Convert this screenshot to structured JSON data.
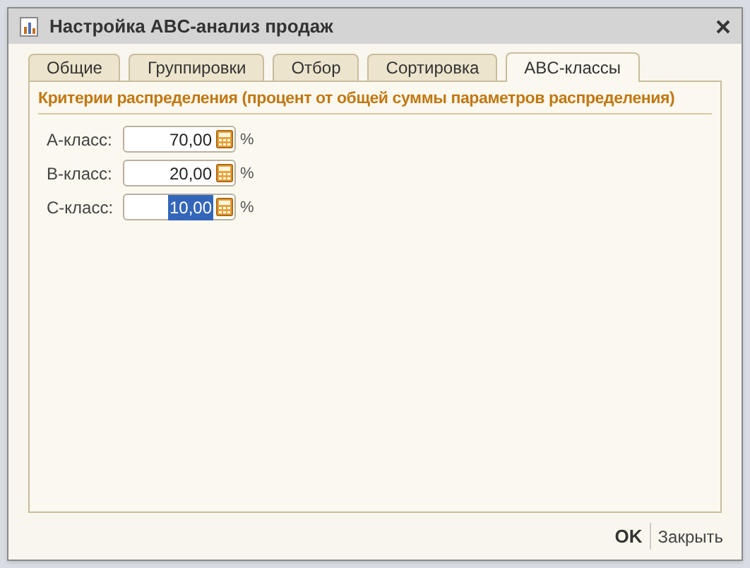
{
  "window": {
    "title": "Настройка ABC-анализ продаж"
  },
  "tabs": [
    {
      "label": "Общие",
      "selected": false
    },
    {
      "label": "Группировки",
      "selected": false
    },
    {
      "label": "Отбор",
      "selected": false
    },
    {
      "label": "Сортировка",
      "selected": false
    },
    {
      "label": "ABC-классы",
      "selected": true
    }
  ],
  "section_title": "Критерии распределения (процент от общей суммы параметров распределения)",
  "fields": [
    {
      "label": "A-класс:",
      "value": "70,00",
      "unit": "%",
      "selected": false
    },
    {
      "label": "B-класс:",
      "value": "20,00",
      "unit": "%",
      "selected": false
    },
    {
      "label": "C-класс:",
      "value": "10,00",
      "unit": "%",
      "selected": true
    }
  ],
  "buttons": [
    {
      "label": "OK",
      "kind": "default"
    },
    {
      "label": "Закрыть",
      "kind": "plain"
    }
  ]
}
